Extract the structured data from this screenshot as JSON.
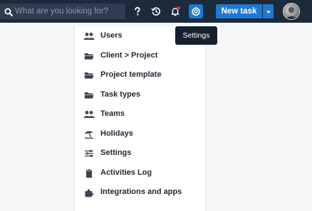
{
  "search": {
    "placeholder": "What are you looking for?",
    "icon": "search-icon"
  },
  "toolbar": {
    "help_icon": "question-icon",
    "history_icon": "history-icon",
    "notifications_icon": "bell-icon",
    "settings_icon": "gear-icon",
    "new_task_label": "New task",
    "new_task_caret_icon": "caret-down-icon",
    "accent_color": "#1f79d1",
    "notification_dot_color": "#e53935"
  },
  "tooltip": {
    "text": "Settings"
  },
  "settings_menu": {
    "items": [
      {
        "label": "Users",
        "icon": "users-icon"
      },
      {
        "label": "Client > Project",
        "icon": "folder-icon"
      },
      {
        "label": "Project template",
        "icon": "folder-icon"
      },
      {
        "label": "Task types",
        "icon": "folder-icon"
      },
      {
        "label": "Teams",
        "icon": "users-icon"
      },
      {
        "label": "Holidays",
        "icon": "beach-umbrella-icon"
      },
      {
        "label": "Settings",
        "icon": "sliders-icon"
      },
      {
        "label": "Activities Log",
        "icon": "clipboard-icon"
      },
      {
        "label": "Integrations and apps",
        "icon": "puzzle-icon"
      }
    ]
  }
}
